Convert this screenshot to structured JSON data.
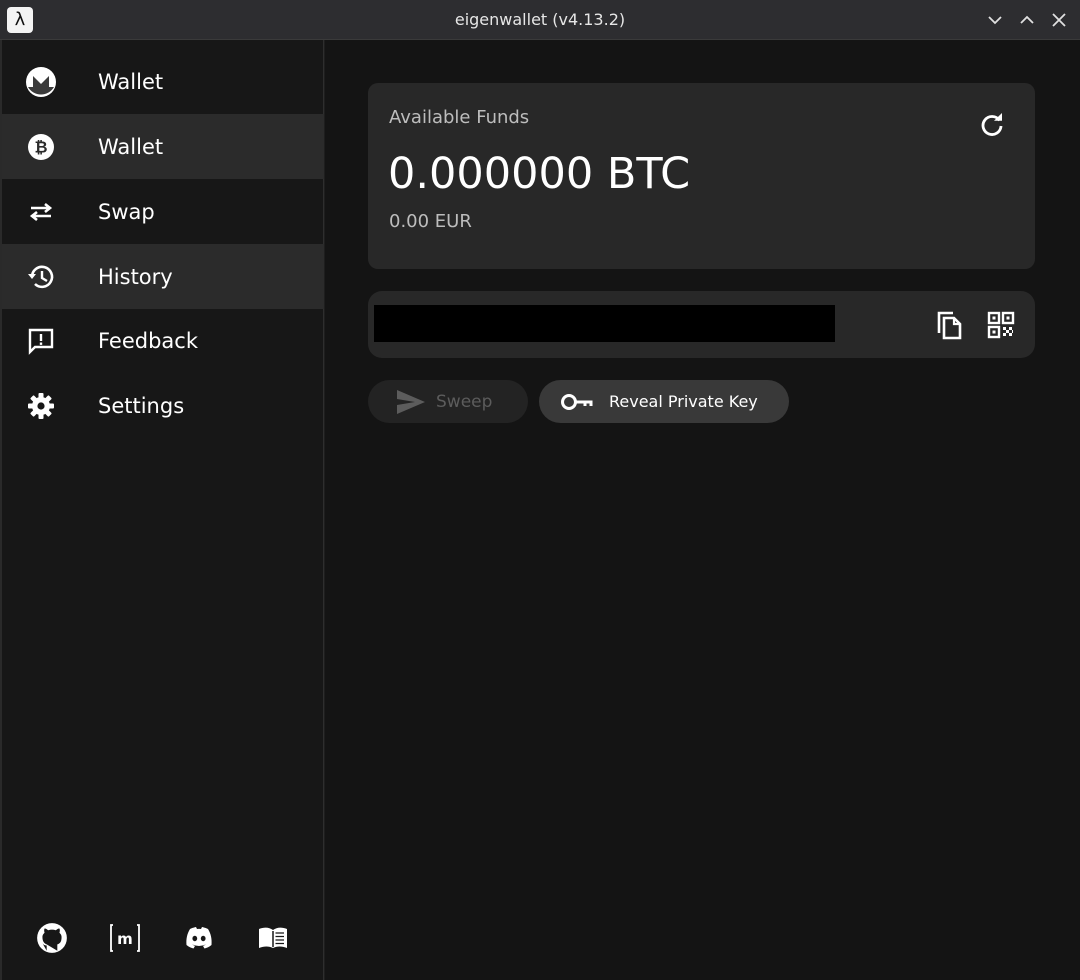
{
  "window": {
    "title": "eigenwallet (v4.13.2)",
    "app_icon_glyph": "λ"
  },
  "sidebar": {
    "items": [
      {
        "label": "Wallet",
        "icon": "monero-icon"
      },
      {
        "label": "Wallet",
        "icon": "bitcoin-icon",
        "active": true
      },
      {
        "label": "Swap",
        "icon": "swap-arrows-icon"
      },
      {
        "label": "History",
        "icon": "history-icon"
      },
      {
        "label": "Feedback",
        "icon": "feedback-icon"
      },
      {
        "label": "Settings",
        "icon": "gear-icon"
      }
    ],
    "footer_icons": [
      "github-icon",
      "matrix-icon",
      "discord-icon",
      "docs-book-icon"
    ]
  },
  "funds": {
    "label": "Available Funds",
    "amount": "0.000000 BTC",
    "fiat": "0.00 EUR"
  },
  "actions": {
    "sweep_label": "Sweep",
    "reveal_label": "Reveal Private Key"
  },
  "colors": {
    "background": "#141414",
    "sidebar": "#171717",
    "card": "#282828",
    "active_item": "#2b2b2b"
  }
}
